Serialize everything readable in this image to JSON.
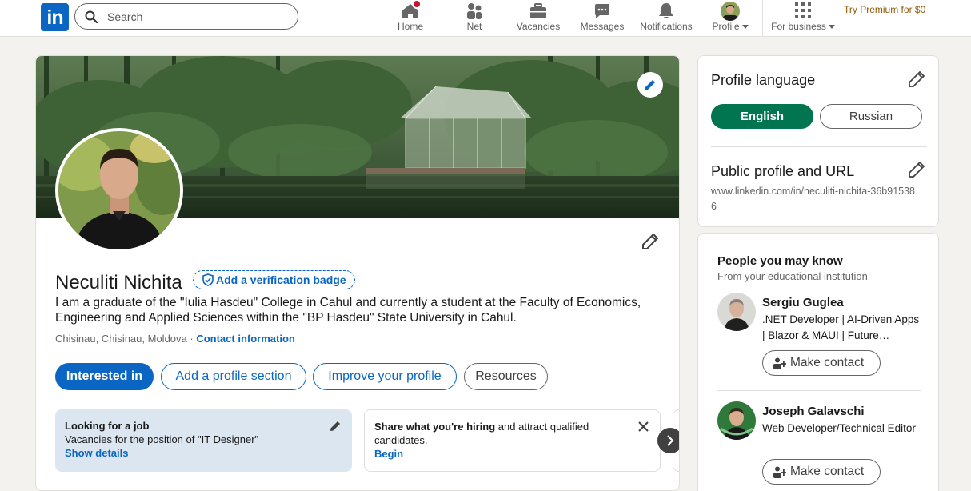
{
  "nav": {
    "logo": "in",
    "search_placeholder": "Search",
    "items": [
      {
        "label": "Home",
        "icon": "home-icon"
      },
      {
        "label": "Net",
        "icon": "network-icon"
      },
      {
        "label": "Vacancies",
        "icon": "briefcase-icon"
      },
      {
        "label": "Messages",
        "icon": "messages-icon"
      },
      {
        "label": "Notifications",
        "icon": "bell-icon"
      },
      {
        "label": "Profile",
        "icon": "me-avatar"
      },
      {
        "label": "For business",
        "icon": "grid-icon"
      }
    ],
    "premium": "Try Premium for $0"
  },
  "profile": {
    "name": "Neculiti Nichita",
    "verification_badge": "Add a verification badge",
    "headline": "I am a graduate of the \"Iulia Hasdeu\" College in Cahul and currently a student at the Faculty of Economics, Engineering and Applied Sciences within the \"BP Hasdeu\" State University in Cahul.",
    "location": "Chisinau, Chisinau, Moldova",
    "location_sep": " · ",
    "contact_info": "Contact information",
    "buttons": {
      "interested": "Interested in",
      "add_section": "Add a profile section",
      "improve": "Improve your profile",
      "resources": "Resources"
    },
    "open_to_work": {
      "title": "Looking for a job",
      "desc": "Vacancies for the position of \"IT Designer\"",
      "link": "Show details"
    },
    "hiring": {
      "title": "Share what you're hiring",
      "desc": " and attract qualified candidates.",
      "link": "Begin"
    }
  },
  "sidebar": {
    "language": {
      "title": "Profile language",
      "options": [
        "English",
        "Russian"
      ],
      "selected": "English"
    },
    "public_profile": {
      "title": "Public profile and URL",
      "url": "www.linkedin.com/in/neculiti-nichita-36b915386"
    },
    "people": {
      "title": "People you may know",
      "subtitle": "From your educational institution",
      "items": [
        {
          "name": "Sergiu Guglea",
          "desc": ".NET Developer | AI-Driven Apps | Blazor & MAUI | Future…",
          "action": "Make contact"
        },
        {
          "name": "Joseph Galavschi",
          "desc": "Web Developer/Technical Editor",
          "action": "Make contact"
        }
      ]
    }
  },
  "colors": {
    "brand": "#0a66c2",
    "language_selected": "#01754f",
    "premium": "#915907",
    "notification_badge": "#cb112d"
  }
}
